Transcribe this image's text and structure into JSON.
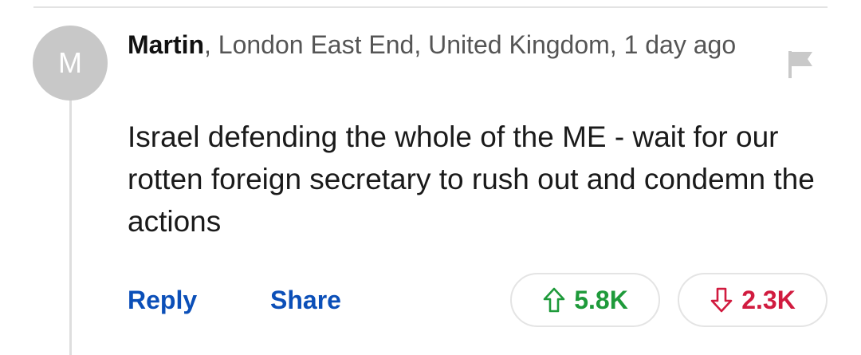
{
  "comment": {
    "avatar_initial": "M",
    "author": "Martin",
    "meta_suffix": ", London East End, United Kingdom, 1 day ago",
    "text": "Israel defending the whole of the ME - wait for our rotten foreign secretary to rush out and condemn the actions",
    "actions": {
      "reply_label": "Reply",
      "share_label": "Share"
    },
    "votes": {
      "up_count": "5.8K",
      "down_count": "2.3K"
    }
  },
  "icons": {
    "flag": "flag-icon",
    "upvote": "arrow-up-icon",
    "downvote": "arrow-down-icon"
  },
  "colors": {
    "link": "#0b4fb8",
    "upvote": "#1e9a3a",
    "downvote": "#d11b3f",
    "avatar_bg": "#c8c8c8"
  }
}
